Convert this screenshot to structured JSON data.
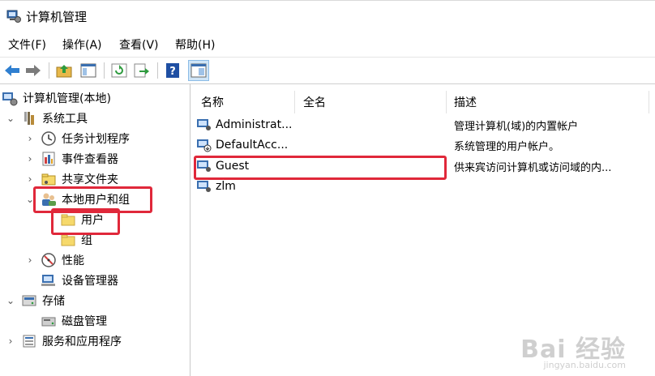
{
  "window": {
    "title": "计算机管理"
  },
  "menu": [
    "文件(F)",
    "操作(A)",
    "查看(V)",
    "帮助(H)"
  ],
  "toolbar_icons": [
    "back-arrow-icon",
    "forward-arrow-icon",
    "up-folder-icon",
    "show-hide-tree-icon",
    "refresh-icon",
    "export-list-icon",
    "help-icon",
    "properties-icon"
  ],
  "tree": {
    "root": "计算机管理(本地)",
    "system_tools": "系统工具",
    "task_scheduler": "任务计划程序",
    "event_viewer": "事件查看器",
    "shared_folders": "共享文件夹",
    "local_users_groups": "本地用户和组",
    "users": "用户",
    "groups": "组",
    "performance": "性能",
    "device_manager": "设备管理器",
    "storage": "存储",
    "disk_management": "磁盘管理",
    "services_apps": "服务和应用程序"
  },
  "list": {
    "headers": {
      "name": "名称",
      "fullname": "全名",
      "desc": "描述"
    },
    "rows": [
      {
        "name": "Administrat...",
        "fullname": "",
        "desc": "管理计算机(域)的内置帐户"
      },
      {
        "name": "DefaultAcc...",
        "fullname": "",
        "desc": "系统管理的用户帐户。"
      },
      {
        "name": "Guest",
        "fullname": "",
        "desc": "供来宾访问计算机或访问域的内..."
      },
      {
        "name": "zlm",
        "fullname": "",
        "desc": ""
      }
    ]
  },
  "watermark": {
    "main": "Bai 经验",
    "sub": "jingyan.baidu.com"
  },
  "colors": {
    "highlight": "#e0283a",
    "folder": "#f6d96b"
  }
}
